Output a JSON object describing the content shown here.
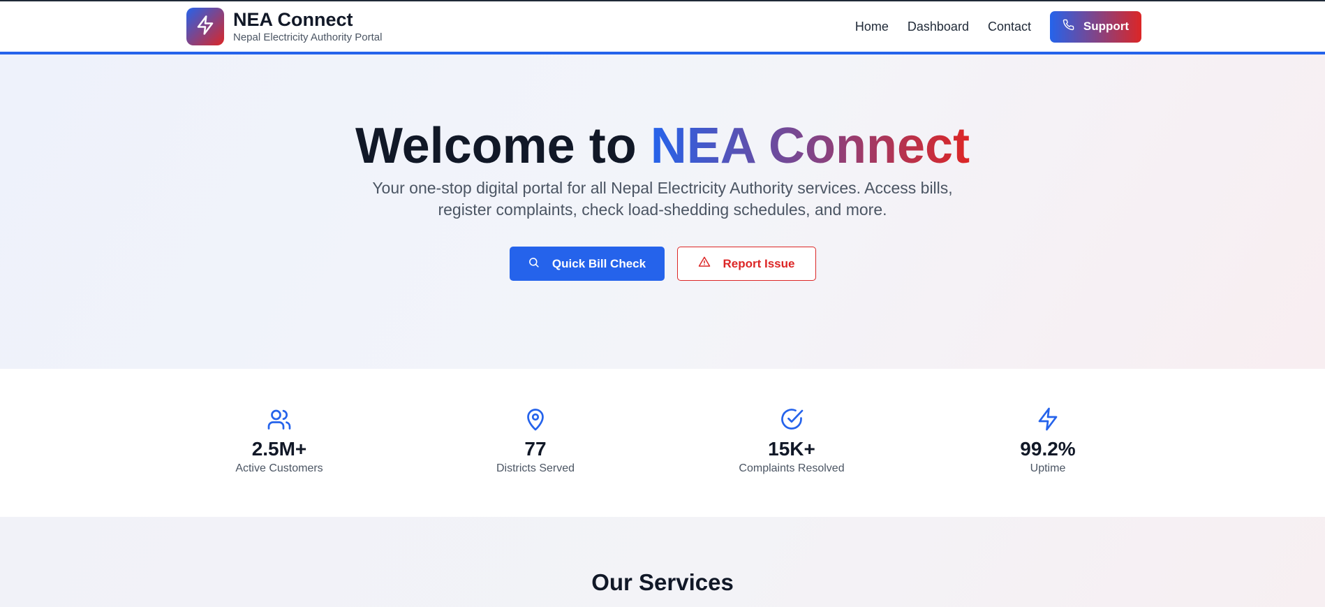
{
  "colors": {
    "primary": "#2563eb",
    "accent": "#dc2626",
    "text_dark": "#111827",
    "text_muted": "#4b5563"
  },
  "header": {
    "logo_icon": "lightning-bolt-icon",
    "title": "NEA Connect",
    "subtitle": "Nepal Electricity Authority Portal",
    "nav": [
      {
        "label": "Home"
      },
      {
        "label": "Dashboard"
      },
      {
        "label": "Contact"
      }
    ],
    "support_icon": "phone-icon",
    "support_label": "Support"
  },
  "hero": {
    "title_prefix": "Welcome to",
    "title_highlight": "NEA Connect",
    "description": "Your one-stop digital portal for all Nepal Electricity Authority services. Access bills, register complaints, check load-shedding schedules, and more.",
    "primary_button": {
      "icon": "search-icon",
      "label": "Quick Bill Check"
    },
    "secondary_button": {
      "icon": "warning-triangle-icon",
      "label": "Report Issue"
    }
  },
  "stats": [
    {
      "icon": "users-icon",
      "value": "2.5M+",
      "label": "Active Customers"
    },
    {
      "icon": "map-pin-icon",
      "value": "77",
      "label": "Districts Served"
    },
    {
      "icon": "check-circle-icon",
      "value": "15K+",
      "label": "Complaints Resolved"
    },
    {
      "icon": "lightning-bolt-icon",
      "value": "99.2%",
      "label": "Uptime"
    }
  ],
  "services": {
    "title": "Our Services"
  }
}
